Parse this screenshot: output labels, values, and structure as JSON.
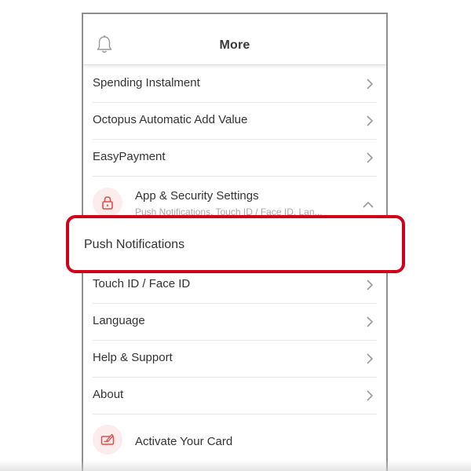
{
  "header": {
    "title": "More",
    "bell_icon": "bell-icon"
  },
  "menu": {
    "spending_instalment": "Spending Instalment",
    "octopus_aav": "Octopus Automatic Add Value",
    "easypayment": "EasyPayment",
    "app_security": {
      "label": "App & Security Settings",
      "sublabel": "Push Notifications, Touch ID / Face ID, Lan...",
      "icon": "lock-icon",
      "expanded": true
    },
    "push_notifications": "Push Notifications",
    "touch_id": "Touch ID / Face ID",
    "language": "Language",
    "help_support": "Help & Support",
    "about": "About",
    "activate_card": {
      "label": "Activate Your Card",
      "icon": "card-activate-icon"
    }
  },
  "colors": {
    "accent": "#d0021b",
    "icon_bg": "#fdecec",
    "icon_fg": "#e04b4b"
  }
}
